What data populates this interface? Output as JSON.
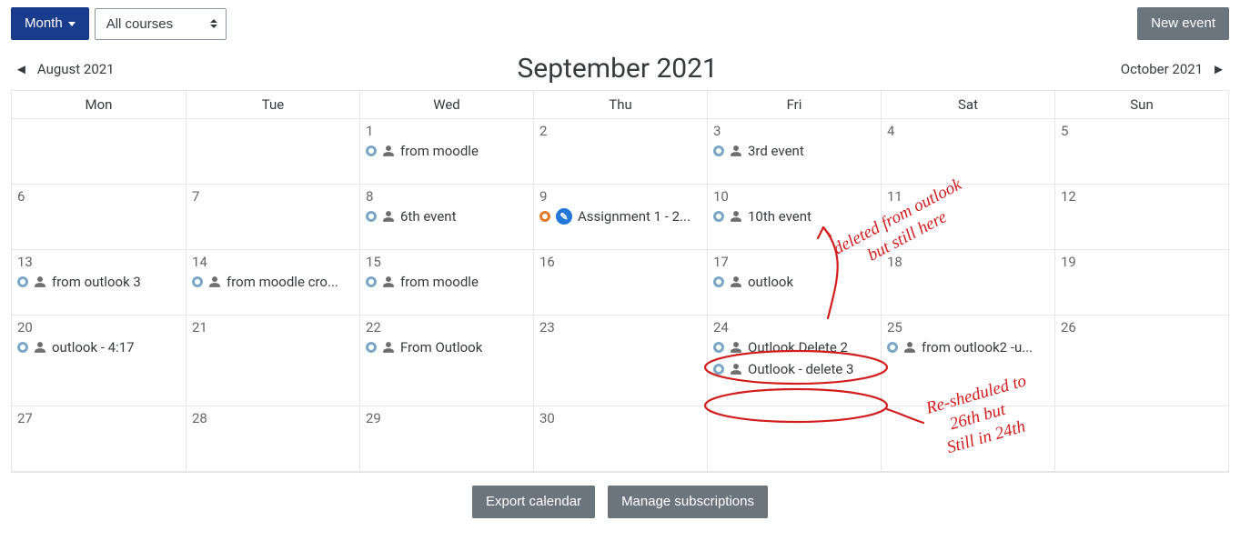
{
  "toolbar": {
    "view_label": "Month",
    "course_filter": "All courses",
    "new_event_label": "New event"
  },
  "nav": {
    "prev_label": "August 2021",
    "title": "September 2021",
    "next_label": "October 2021"
  },
  "day_headers": [
    "Mon",
    "Tue",
    "Wed",
    "Thu",
    "Fri",
    "Sat",
    "Sun"
  ],
  "weeks": [
    [
      {
        "num": ""
      },
      {
        "num": ""
      },
      {
        "num": "1",
        "events": [
          {
            "kind": "user",
            "label": "from moodle"
          }
        ]
      },
      {
        "num": "2"
      },
      {
        "num": "3",
        "events": [
          {
            "kind": "user",
            "label": "3rd event"
          }
        ]
      },
      {
        "num": "4"
      },
      {
        "num": "5"
      }
    ],
    [
      {
        "num": "6"
      },
      {
        "num": "7"
      },
      {
        "num": "8",
        "events": [
          {
            "kind": "user",
            "label": "6th event"
          }
        ]
      },
      {
        "num": "9",
        "events": [
          {
            "kind": "assign",
            "label": "Assignment 1 - 2..."
          }
        ]
      },
      {
        "num": "10",
        "events": [
          {
            "kind": "user",
            "label": "10th event"
          }
        ]
      },
      {
        "num": "11"
      },
      {
        "num": "12"
      }
    ],
    [
      {
        "num": "13",
        "events": [
          {
            "kind": "user",
            "label": "from outlook 3"
          }
        ]
      },
      {
        "num": "14",
        "events": [
          {
            "kind": "user",
            "label": "from moodle cro..."
          }
        ]
      },
      {
        "num": "15",
        "events": [
          {
            "kind": "user",
            "label": "from moodle"
          }
        ]
      },
      {
        "num": "16"
      },
      {
        "num": "17",
        "events": [
          {
            "kind": "user",
            "label": "outlook"
          }
        ]
      },
      {
        "num": "18"
      },
      {
        "num": "19"
      }
    ],
    [
      {
        "num": "20",
        "events": [
          {
            "kind": "user",
            "label": "outlook - 4:17"
          }
        ]
      },
      {
        "num": "21"
      },
      {
        "num": "22",
        "events": [
          {
            "kind": "user",
            "label": "From Outlook"
          }
        ]
      },
      {
        "num": "23"
      },
      {
        "num": "24",
        "events": [
          {
            "kind": "user",
            "label": "Outlook Delete 2"
          },
          {
            "kind": "user",
            "label": "Outlook - delete 3"
          }
        ]
      },
      {
        "num": "25",
        "events": [
          {
            "kind": "user",
            "label": "from outlook2 -u..."
          }
        ]
      },
      {
        "num": "26"
      }
    ],
    [
      {
        "num": "27"
      },
      {
        "num": "28"
      },
      {
        "num": "29"
      },
      {
        "num": "30"
      },
      {
        "num": ""
      },
      {
        "num": ""
      },
      {
        "num": ""
      }
    ]
  ],
  "footer": {
    "export_label": "Export calendar",
    "manage_label": "Manage subscriptions"
  },
  "annotations": {
    "note1_l1": "deleted from outlook",
    "note1_l2": "but still here",
    "note2_l1": "Re-sheduled to",
    "note2_l2": "26th but",
    "note2_l3": "Still in 24th"
  }
}
